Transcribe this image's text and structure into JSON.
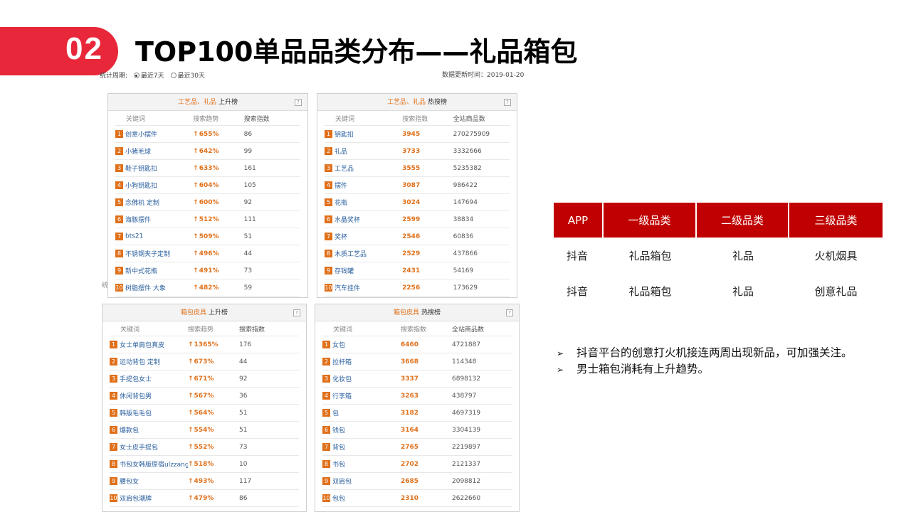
{
  "header": {
    "number": "02",
    "title": "TOP100单品品类分布——礼品箱包"
  },
  "meta": {
    "period_label": "统计周期:",
    "option_7": "最近7天",
    "option_30": "最近30天",
    "updated": "数据更新时间：2019-01-20",
    "stray": "统"
  },
  "panels": [
    {
      "category": "工艺品、礼品",
      "kind": "上升榜",
      "columns": [
        "关键词",
        "搜索趋势",
        "搜索指数"
      ],
      "rows": [
        {
          "rank": "1",
          "kw": "创意小摆件",
          "v1": "655%",
          "v2": "86"
        },
        {
          "rank": "2",
          "kw": "小猪毛球",
          "v1": "642%",
          "v2": "99"
        },
        {
          "rank": "3",
          "kw": "鞋子钥匙扣",
          "v1": "633%",
          "v2": "161"
        },
        {
          "rank": "4",
          "kw": "小狗钥匙扣",
          "v1": "604%",
          "v2": "105"
        },
        {
          "rank": "5",
          "kw": "念佛机 定制",
          "v1": "600%",
          "v2": "92"
        },
        {
          "rank": "6",
          "kw": "海豚摆件",
          "v1": "512%",
          "v2": "111"
        },
        {
          "rank": "7",
          "kw": "bts21",
          "v1": "509%",
          "v2": "51"
        },
        {
          "rank": "8",
          "kw": "不锈钢夹子定制",
          "v1": "496%",
          "v2": "44"
        },
        {
          "rank": "9",
          "kw": "新中式花瓶",
          "v1": "491%",
          "v2": "73"
        },
        {
          "rank": "10",
          "kw": "树脂摆件 大象",
          "v1": "482%",
          "v2": "59"
        }
      ]
    },
    {
      "category": "工艺品、礼品",
      "kind": "热搜榜",
      "columns": [
        "关键词",
        "搜索指数",
        "全站商品数"
      ],
      "rows": [
        {
          "rank": "1",
          "kw": "钥匙扣",
          "v1": "3945",
          "v2": "270275909"
        },
        {
          "rank": "2",
          "kw": "礼品",
          "v1": "3733",
          "v2": "3332666"
        },
        {
          "rank": "3",
          "kw": "工艺品",
          "v1": "3555",
          "v2": "5235382"
        },
        {
          "rank": "4",
          "kw": "摆件",
          "v1": "3087",
          "v2": "986422"
        },
        {
          "rank": "5",
          "kw": "花瓶",
          "v1": "3024",
          "v2": "147694"
        },
        {
          "rank": "6",
          "kw": "水晶奖杯",
          "v1": "2599",
          "v2": "38834"
        },
        {
          "rank": "7",
          "kw": "奖杯",
          "v1": "2546",
          "v2": "60836"
        },
        {
          "rank": "8",
          "kw": "木质工艺品",
          "v1": "2529",
          "v2": "437866"
        },
        {
          "rank": "9",
          "kw": "存钱罐",
          "v1": "2431",
          "v2": "54169"
        },
        {
          "rank": "10",
          "kw": "汽车挂件",
          "v1": "2256",
          "v2": "173629"
        }
      ]
    },
    {
      "category": "箱包皮具",
      "kind": "上升榜",
      "columns": [
        "关键词",
        "搜索趋势",
        "搜索指数"
      ],
      "rows": [
        {
          "rank": "1",
          "kw": "女士单肩包真皮",
          "v1": "1365%",
          "v2": "176"
        },
        {
          "rank": "2",
          "kw": "运动背包 定制",
          "v1": "673%",
          "v2": "44"
        },
        {
          "rank": "3",
          "kw": "手提包女士",
          "v1": "671%",
          "v2": "92"
        },
        {
          "rank": "4",
          "kw": "休闲背包男",
          "v1": "567%",
          "v2": "36"
        },
        {
          "rank": "5",
          "kw": "韩版毛毛包",
          "v1": "564%",
          "v2": "51"
        },
        {
          "rank": "6",
          "kw": "爆款包",
          "v1": "554%",
          "v2": "51"
        },
        {
          "rank": "7",
          "kw": "女士皮手提包",
          "v1": "552%",
          "v2": "73"
        },
        {
          "rank": "8",
          "kw": "书包女韩版原宿ulzzang",
          "v1": "518%",
          "v2": "10"
        },
        {
          "rank": "9",
          "kw": "腰包女",
          "v1": "493%",
          "v2": "117"
        },
        {
          "rank": "10",
          "kw": "双肩包潮牌",
          "v1": "479%",
          "v2": "86"
        }
      ]
    },
    {
      "category": "箱包皮具",
      "kind": "热搜榜",
      "columns": [
        "关键词",
        "搜索指数",
        "全站商品数"
      ],
      "rows": [
        {
          "rank": "1",
          "kw": "女包",
          "v1": "6460",
          "v2": "4721887"
        },
        {
          "rank": "2",
          "kw": "拉杆箱",
          "v1": "3668",
          "v2": "114348"
        },
        {
          "rank": "3",
          "kw": "化妆包",
          "v1": "3337",
          "v2": "6898132"
        },
        {
          "rank": "4",
          "kw": "行李箱",
          "v1": "3263",
          "v2": "438797"
        },
        {
          "rank": "5",
          "kw": "包",
          "v1": "3182",
          "v2": "4697319"
        },
        {
          "rank": "6",
          "kw": "钱包",
          "v1": "3164",
          "v2": "3304139"
        },
        {
          "rank": "7",
          "kw": "背包",
          "v1": "2765",
          "v2": "2219897"
        },
        {
          "rank": "8",
          "kw": "书包",
          "v1": "2702",
          "v2": "2121337"
        },
        {
          "rank": "9",
          "kw": "双肩包",
          "v1": "2685",
          "v2": "2098812"
        },
        {
          "rank": "10",
          "kw": "包包",
          "v1": "2310",
          "v2": "2622660"
        }
      ]
    }
  ],
  "category_table": {
    "headers": [
      "APP",
      "一级品类",
      "二级品类",
      "三级品类"
    ],
    "rows": [
      [
        "抖音",
        "礼品箱包",
        "礼品",
        "火机烟具"
      ],
      [
        "抖音",
        "礼品箱包",
        "礼品",
        "创意礼品"
      ]
    ]
  },
  "notes": [
    "抖音平台的创意打火机接连两周出现新品，可加强关注。",
    "男士箱包消耗有上升趋势。"
  ]
}
